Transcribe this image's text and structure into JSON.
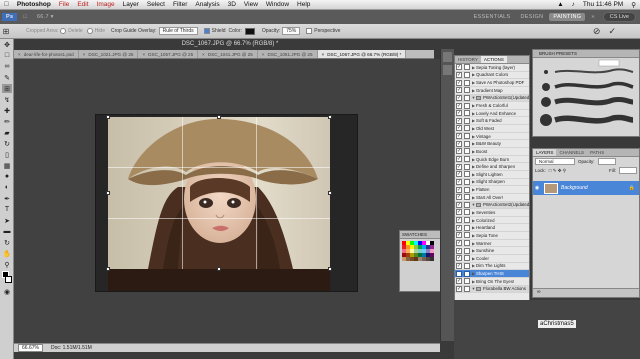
{
  "menubar": {
    "app": "Photoshop",
    "items": [
      "File",
      "Edit",
      "Image",
      "Layer",
      "Select",
      "Filter",
      "Analysis",
      "3D",
      "View",
      "Window",
      "Help"
    ],
    "clock": "Thu 11:46 PM"
  },
  "appbar": {
    "workspaces": [
      "ESSENTIALS",
      "DESIGN",
      "PAINTING"
    ],
    "active_workspace": "PAINTING",
    "cs_live": "CS Live"
  },
  "options": {
    "cropped_area": "Cropped Area:",
    "delete": "Delete",
    "hide": "Hide",
    "overlay_label": "Crop Guide Overlay:",
    "overlay_value": "Rule of Thirds",
    "shield": "Shield",
    "color": "Color:",
    "opacity": "Opacity:",
    "opacity_value": "75%",
    "perspective": "Perspective"
  },
  "doc_title": "DSC_1067.JPG @ 66.7% (RGB/8) *",
  "tabs": [
    "dear-life-for-photos1.psd",
    "DSC_1021.JPG @ 25",
    "DSC_1057.JPG @ 25",
    "DSC_1041.JPG @ 25",
    "DSC_1051.JPG @ 25",
    "DSC_1067.JPG @ 66.7% (RGB/8) *"
  ],
  "active_tab_index": 5,
  "status": {
    "zoom": "66.67%",
    "doc": "Doc: 1.51M/1.51M"
  },
  "swatches": {
    "title": "SWATCHES",
    "colors": [
      "#ff0000",
      "#ffff00",
      "#00ff00",
      "#00ffff",
      "#0000ff",
      "#ff00ff",
      "#ffffff",
      "#000000",
      "#ed1c24",
      "#f7941d",
      "#fff200",
      "#8dc63f",
      "#00a651",
      "#00aeef",
      "#2e3192",
      "#92278f",
      "#f26d7d",
      "#fbaf5d",
      "#fff799",
      "#a3d39c",
      "#7accc8",
      "#6dcff6",
      "#8781bd",
      "#f49ac2",
      "#9e0b0f",
      "#a0410d",
      "#aba000",
      "#598527",
      "#007236",
      "#0076a3",
      "#1b1464",
      "#630460",
      "#c69c6d",
      "#8c6239",
      "#754c24",
      "#603913",
      "#998675",
      "#736357",
      "#534741",
      "#362f2d"
    ]
  },
  "actions_panel": {
    "tabs": [
      "HISTORY",
      "ACTIONS"
    ],
    "active_tab": "ACTIONS",
    "items": [
      {
        "label": "Sepia Toning (layer)",
        "type": "action"
      },
      {
        "label": "Quadrant Colors",
        "type": "action"
      },
      {
        "label": "Save As Photoshop PDF",
        "type": "action"
      },
      {
        "label": "Gradient Map",
        "type": "action"
      },
      {
        "label": "PWActionSet1(Updated)",
        "type": "set"
      },
      {
        "label": "Fresh & Colorful",
        "type": "action"
      },
      {
        "label": "Lovely And Enhance",
        "type": "action"
      },
      {
        "label": "Soft & Faded",
        "type": "action"
      },
      {
        "label": "Old West",
        "type": "action"
      },
      {
        "label": "Vintage",
        "type": "action"
      },
      {
        "label": "B&W Beauty",
        "type": "action"
      },
      {
        "label": "Boost",
        "type": "action"
      },
      {
        "label": "Quick Edge Burn",
        "type": "action"
      },
      {
        "label": "Define and Sharpen",
        "type": "action"
      },
      {
        "label": "Slight Lighten",
        "type": "action"
      },
      {
        "label": "Slight Sharpen",
        "type": "action"
      },
      {
        "label": "Flatten",
        "type": "action"
      },
      {
        "label": "Start All Over!",
        "type": "action"
      },
      {
        "label": "PWActionSet2(Updated)",
        "type": "set"
      },
      {
        "label": "Seventies",
        "type": "action"
      },
      {
        "label": "Colorized",
        "type": "action"
      },
      {
        "label": "Heartland",
        "type": "action"
      },
      {
        "label": "Sepia Tone",
        "type": "action"
      },
      {
        "label": "Warmer",
        "type": "action"
      },
      {
        "label": "Sunshine",
        "type": "action"
      },
      {
        "label": "Cooler",
        "type": "action"
      },
      {
        "label": "Dim The Lights",
        "type": "action"
      },
      {
        "label": "Sharpen THIS",
        "type": "action",
        "selected": true
      },
      {
        "label": "Bring On The Eyes!",
        "type": "action"
      },
      {
        "label": "Florabella BW Actions",
        "type": "set"
      }
    ]
  },
  "brush_panel": {
    "title": "BRUSH PRESETS"
  },
  "layers_panel": {
    "tabs": [
      "LAYERS",
      "CHANNELS",
      "PATHS"
    ],
    "active_tab": "LAYERS",
    "blend_mode": "Normal",
    "opacity_label": "Opacity:",
    "lock_label": "Lock:",
    "fill_label": "Fill:",
    "layer_name": "Background"
  },
  "desktop_label": "aChristmas5"
}
